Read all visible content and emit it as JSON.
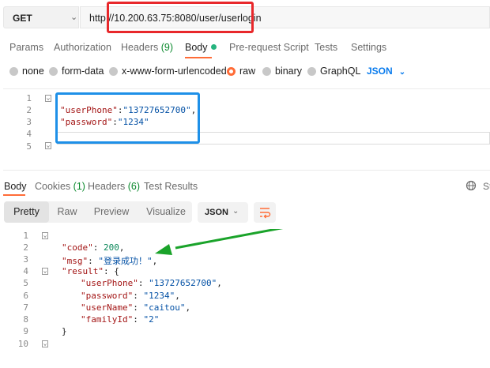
{
  "request": {
    "method": "GET",
    "url": "http://10.200.63.75:8080/user/userlogin"
  },
  "request_tabs": {
    "params": "Params",
    "authorization": "Authorization",
    "headers": "Headers",
    "headers_count": "(9)",
    "body": "Body",
    "pre_request_script": "Pre-request Script",
    "tests": "Tests",
    "settings": "Settings"
  },
  "body_types": {
    "none": "none",
    "form_data": "form-data",
    "urlencoded": "x-www-form-urlencoded",
    "raw": "raw",
    "binary": "binary",
    "graphql": "GraphQL",
    "selected": "raw",
    "language": "JSON"
  },
  "request_body": {
    "line_numbers": [
      "1",
      "2",
      "3",
      "4",
      "5"
    ],
    "open_brace": "{",
    "close_brace": "}",
    "field1_key": "\"userPhone\"",
    "field1_value": "\"13727652700\"",
    "field2_key": "\"password\"",
    "field2_value": "\"1234\""
  },
  "response_tabs": {
    "body": "Body",
    "cookies": "Cookies",
    "cookies_count": "(1)",
    "headers": "Headers",
    "headers_count": "(6)",
    "test_results": "Test Results",
    "cut_text": "St"
  },
  "view_modes": {
    "pretty": "Pretty",
    "raw": "Raw",
    "preview": "Preview",
    "visualize": "Visualize",
    "format": "JSON"
  },
  "response_body": {
    "line_numbers": [
      "1",
      "2",
      "3",
      "4",
      "5",
      "6",
      "7",
      "8",
      "9",
      "10"
    ],
    "open_brace": "{",
    "code_key": "\"code\"",
    "code_value": "200",
    "msg_key": "\"msg\"",
    "msg_value": "\"登录成功！\"",
    "result_key": "\"result\"",
    "userPhone_key": "\"userPhone\"",
    "userPhone_value": "\"13727652700\"",
    "password_key": "\"password\"",
    "password_value": "\"1234\"",
    "userName_key": "\"userName\"",
    "userName_value": "\"caitou\"",
    "familyId_key": "\"familyId\"",
    "familyId_value": "\"2\"",
    "inner_close": "}",
    "outer_close": "}"
  },
  "colors": {
    "accent": "#ff6c37",
    "red_annotation": "#e8282b",
    "blue_annotation": "#1e90e8",
    "green_annotation": "#1aa32a",
    "json_key": "#a31515",
    "json_string": "#0451a5",
    "json_number": "#098658"
  },
  "icons": [
    "chevron-down-icon",
    "globe-icon",
    "wrap-lines-icon",
    "fold-icon",
    "arrow-annotation"
  ]
}
